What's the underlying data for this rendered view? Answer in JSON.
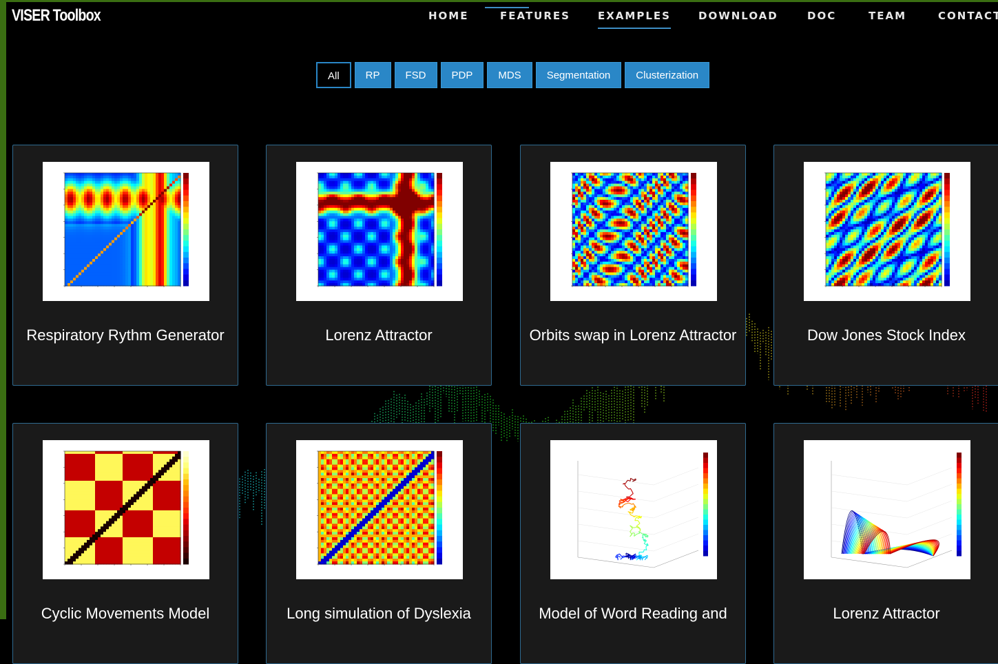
{
  "header": {
    "logo": "VISER Toolbox",
    "nav": [
      {
        "label": "HOME",
        "active": false
      },
      {
        "label": "FEATURES",
        "active": false
      },
      {
        "label": "EXAMPLES",
        "active": true
      },
      {
        "label": "DOWNLOAD",
        "active": false
      },
      {
        "label": "DOC",
        "active": false
      },
      {
        "label": "TEAM",
        "active": false
      },
      {
        "label": "CONTACT",
        "active": false
      }
    ]
  },
  "filters": [
    {
      "label": "All",
      "active": true
    },
    {
      "label": "RP",
      "active": false
    },
    {
      "label": "FSD",
      "active": false
    },
    {
      "label": "PDP",
      "active": false
    },
    {
      "label": "MDS",
      "active": false
    },
    {
      "label": "Segmentation",
      "active": false
    },
    {
      "label": "Clusterization",
      "active": false
    }
  ],
  "examples": [
    {
      "title": "Respiratory Rythm Generator",
      "thumbnail": "recurrence-plot"
    },
    {
      "title": "Lorenz Attractor",
      "thumbnail": "recurrence-plot"
    },
    {
      "title": "Orbits swap in Lorenz Attractor",
      "thumbnail": "recurrence-plot"
    },
    {
      "title": "Dow Jones Stock Index",
      "thumbnail": "recurrence-plot"
    },
    {
      "title": "Cyclic Movements Model",
      "thumbnail": "recurrence-plot"
    },
    {
      "title": "Long simulation of Dyslexia",
      "thumbnail": "recurrence-plot"
    },
    {
      "title": "Model of Word Reading and",
      "thumbnail": "3d-trajectory-plot"
    },
    {
      "title": "Lorenz Attractor",
      "thumbnail": "3d-trajectory-plot"
    }
  ],
  "colors": {
    "accent": "#2a87c7",
    "card_border": "#2f6a90",
    "card_bg": "#1a1a1a",
    "frame": "#3a6e12"
  }
}
